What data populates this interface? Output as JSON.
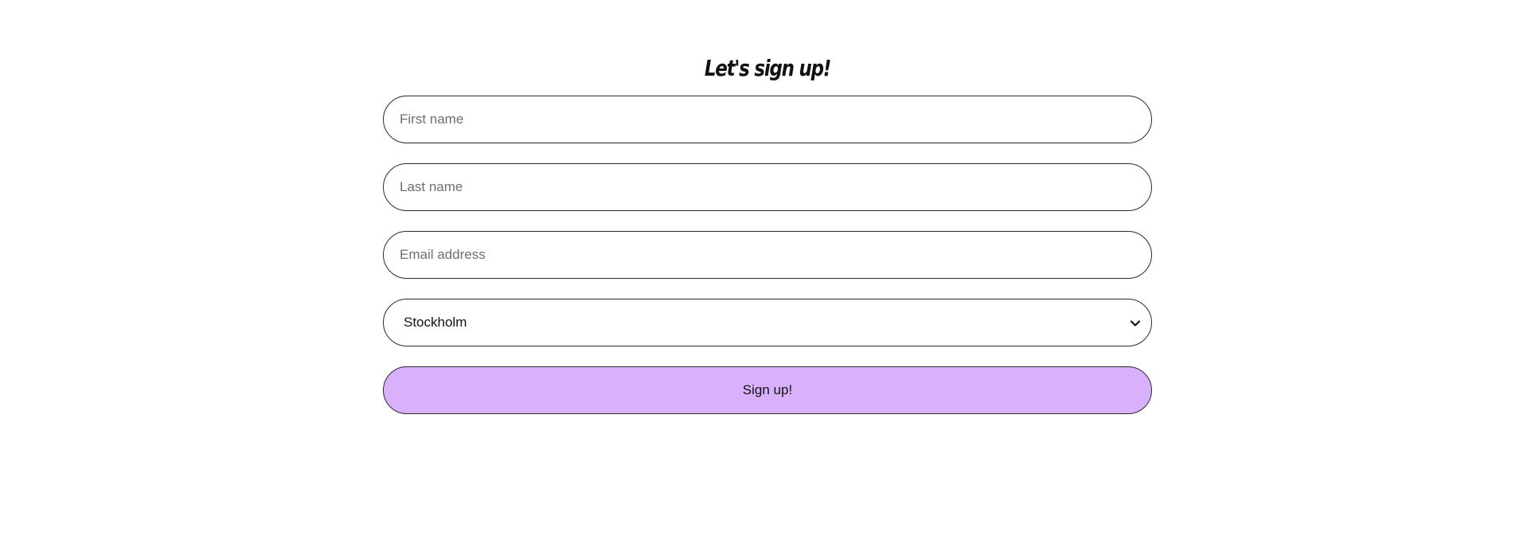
{
  "form": {
    "title": "Let's sign up!",
    "first_name_placeholder": "First name",
    "last_name_placeholder": "Last name",
    "email_placeholder": "Email address",
    "city_selected": "Stockholm",
    "submit_label": "Sign up!"
  },
  "icons": {
    "select_chevron": "chevron-down-icon"
  },
  "colors": {
    "background": "#ffffff",
    "border": "#2b2b2b",
    "button_fill": "#d8b0fb",
    "text": "#111111",
    "placeholder": "#6e6e6e"
  }
}
